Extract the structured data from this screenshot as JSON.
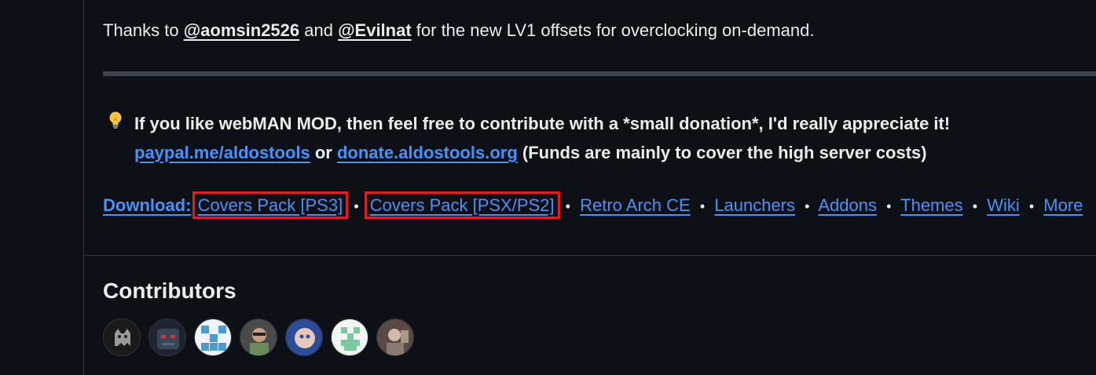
{
  "thanks": {
    "prefix": "Thanks to ",
    "mention1": "@aomsin2526",
    "middle": " and ",
    "mention2": "@Evilnat",
    "suffix": " for the new LV1 offsets for overclocking on-demand."
  },
  "donation": {
    "icon": "lightbulb-icon",
    "line1": "If you like webMAN MOD, then feel free to contribute with a *small donation*, I'd really appreciate it!",
    "link1": "paypal.me/aldostools",
    "or": " or ",
    "link2": "donate.aldostools.org",
    "note": " (Funds are mainly to cover the high server costs)"
  },
  "download": {
    "label": "Download:",
    "links": [
      "Covers Pack [PS3]",
      "Covers Pack [PSX/PS2]",
      "Retro Arch CE",
      "Launchers",
      "Addons",
      "Themes",
      "Wiki",
      "More"
    ],
    "separator": "•"
  },
  "contributors": {
    "title": "Contributors",
    "avatars": [
      {
        "name": "contributor-1",
        "color": "#3a3a3a"
      },
      {
        "name": "contributor-2",
        "color": "#2b3440"
      },
      {
        "name": "contributor-3",
        "color": "#5aa7d4"
      },
      {
        "name": "contributor-4",
        "color": "#6b5a48"
      },
      {
        "name": "contributor-5",
        "color": "#4a6fb0"
      },
      {
        "name": "contributor-6",
        "color": "#8fd3b0"
      },
      {
        "name": "contributor-7",
        "color": "#7a6a60"
      }
    ]
  },
  "colors": {
    "link": "#4493f8",
    "highlight_box": "#e51b24",
    "background": "#0d1117"
  }
}
